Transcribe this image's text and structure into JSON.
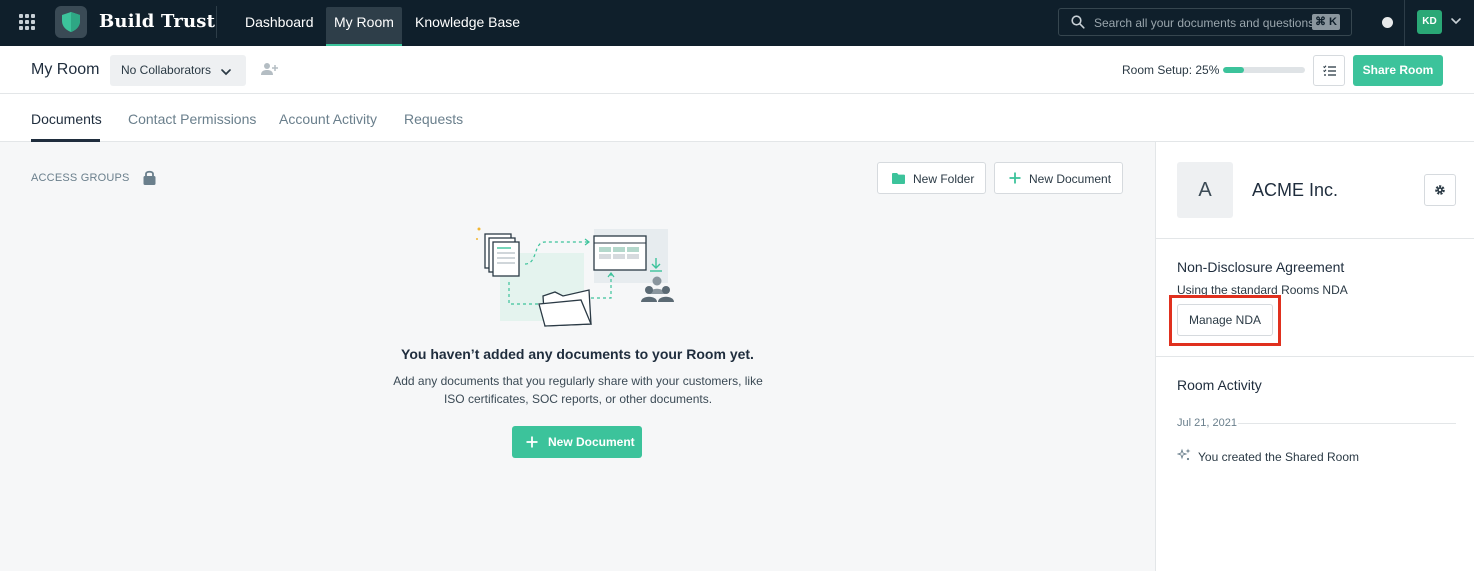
{
  "app": {
    "brand": "Build Trust",
    "nav": [
      {
        "label": "Dashboard"
      },
      {
        "label": "My Room"
      },
      {
        "label": "Knowledge Base"
      }
    ],
    "search_placeholder": "Search all your documents and questions",
    "search_shortcut": "⌘ K",
    "user_initials": "KD"
  },
  "header": {
    "title": "My Room",
    "collaborators_select": "No Collaborators",
    "setup_label": "Room Setup: 25%",
    "setup_progress": 0.25,
    "share_button": "Share Room"
  },
  "tabs": [
    {
      "label": "Documents",
      "active": true
    },
    {
      "label": "Contact Permissions",
      "active": false
    },
    {
      "label": "Account Activity",
      "active": false
    },
    {
      "label": "Requests",
      "active": false
    }
  ],
  "main": {
    "access_groups_label": "ACCESS GROUPS",
    "new_folder_button": "New Folder",
    "new_document_button": "New Document",
    "empty_title": "You haven’t added any documents to your Room yet.",
    "empty_description": "Add any documents that you regularly share with your customers, like ISO certificates, SOC reports, or other documents.",
    "empty_cta": "New Document"
  },
  "panel": {
    "org_initial": "A",
    "org_name": "ACME Inc.",
    "nda_title": "Non-Disclosure Agreement",
    "nda_subtitle": "Using the standard Rooms NDA",
    "manage_nda_button": "Manage NDA",
    "activity_title": "Room Activity",
    "activity_date": "Jul 21, 2021",
    "activity_item": "You created the Shared Room"
  },
  "colors": {
    "accent": "#3cc39b",
    "topnav_bg": "#0f1f2b",
    "highlight": "#e0301e"
  },
  "icons": [
    "apps-grid-icon",
    "shield-logo-icon",
    "search-icon",
    "chevron-down-icon",
    "add-user-icon",
    "checklist-icon",
    "lock-icon",
    "folder-icon",
    "plus-icon",
    "gear-icon",
    "sparkle-icon"
  ]
}
